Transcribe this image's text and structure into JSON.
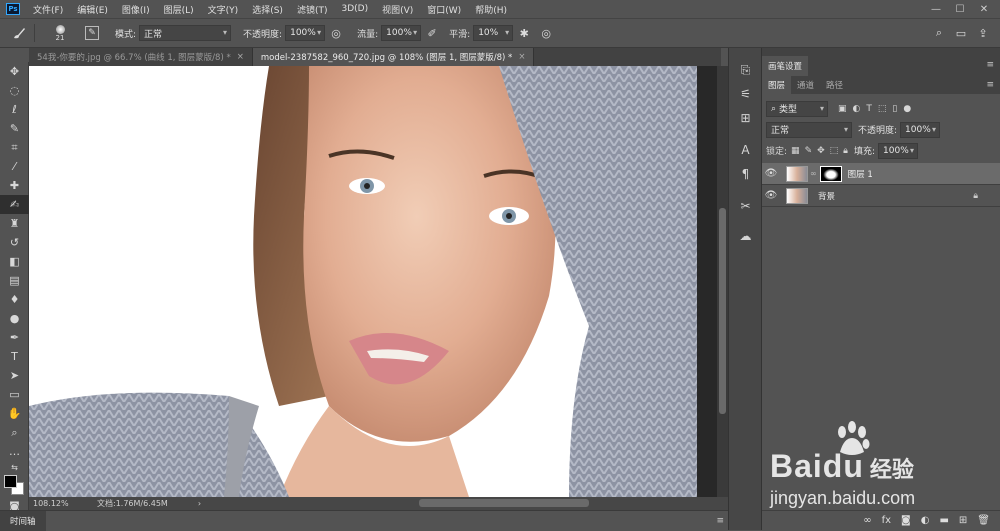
{
  "menubar": {
    "logo": "Ps",
    "items": [
      "文件(F)",
      "编辑(E)",
      "图像(I)",
      "图层(L)",
      "文字(Y)",
      "选择(S)",
      "滤镜(T)",
      "3D(D)",
      "视图(V)",
      "窗口(W)",
      "帮助(H)"
    ],
    "window_controls": [
      "—",
      "☐",
      "✕"
    ]
  },
  "options": {
    "brush_size": "21",
    "mode_label": "模式:",
    "mode_value": "正常",
    "opacity_label": "不透明度:",
    "opacity_value": "100%",
    "flow_label": "流量:",
    "flow_value": "100%",
    "smooth_label": "平滑:",
    "smooth_value": "10%"
  },
  "tabs": [
    {
      "label": "54我-你要的.jpg @ 66.7% (曲线 1, 图层蒙版/8) *",
      "close": "×"
    },
    {
      "label": "model-2387582_960_720.jpg @ 108% (图层 1, 图层蒙版/8) *",
      "close": "×"
    }
  ],
  "status": {
    "zoom": "108.12%",
    "doc": "文档:1.76M/6.45M",
    "arrow": "›"
  },
  "timeline": {
    "label": "时间轴"
  },
  "panel": {
    "header": "画笔设置",
    "tabs": [
      "图层",
      "通道",
      "路径"
    ],
    "filter_kind": "类型",
    "blend_mode": "正常",
    "opacity_label": "不透明度:",
    "opacity_value": "100%",
    "lock_label": "锁定:",
    "fill_label": "填充:",
    "fill_value": "100%",
    "layers": [
      {
        "name": "图层 1",
        "selected": true
      },
      {
        "name": "背景",
        "locked": true
      }
    ]
  },
  "watermark": {
    "brand": "Baidu",
    "suffix": "经验",
    "url": "jingyan.baidu.com"
  },
  "colors": {
    "bg": "#535353",
    "dark": "#424242",
    "accent": "#31a8ff"
  }
}
